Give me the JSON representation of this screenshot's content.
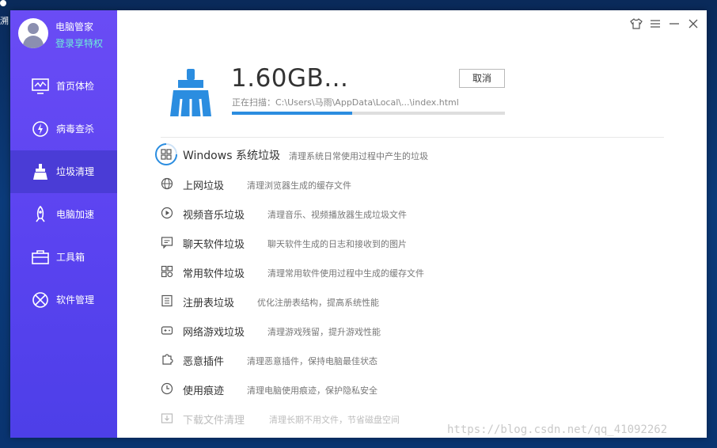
{
  "desktop": {
    "icon_text": "溯"
  },
  "app": {
    "user": {
      "name": "电脑管家",
      "login_link": "登录享特权"
    },
    "nav": [
      {
        "label": "首页体检",
        "icon": "monitor-icon",
        "active": false
      },
      {
        "label": "病毒查杀",
        "icon": "virus-scan-icon",
        "active": false
      },
      {
        "label": "垃圾清理",
        "icon": "broom-icon",
        "active": true
      },
      {
        "label": "电脑加速",
        "icon": "rocket-icon",
        "active": false
      },
      {
        "label": "工具箱",
        "icon": "toolbox-icon",
        "active": false
      },
      {
        "label": "软件管理",
        "icon": "software-icon",
        "active": false
      }
    ],
    "window_controls": [
      "skin-icon",
      "menu-icon",
      "minimize-icon",
      "close-icon"
    ]
  },
  "scan": {
    "size": "1.60GB...",
    "cancel_label": "取消",
    "path_prefix": "正在扫描：",
    "path": "C:\\Users\\马雨\\AppData\\Local\\...\\index.html",
    "progress": 0.44,
    "accent": "#2b8de0"
  },
  "items": [
    {
      "title": "Windows 系统垃圾",
      "desc": "清理系统日常使用过程中产生的垃圾",
      "icon": "windows-scanning-icon"
    },
    {
      "title": "上网垃圾",
      "desc": "清理浏览器生成的缓存文件",
      "icon": "globe-icon"
    },
    {
      "title": "视频音乐垃圾",
      "desc": "清理音乐、视频播放器生成垃圾文件",
      "icon": "play-icon"
    },
    {
      "title": "聊天软件垃圾",
      "desc": "聊天软件生成的日志和接收到的图片",
      "icon": "chat-icon"
    },
    {
      "title": "常用软件垃圾",
      "desc": "清理常用软件使用过程中生成的缓存文件",
      "icon": "apps-icon"
    },
    {
      "title": "注册表垃圾",
      "desc": "优化注册表结构，提高系统性能",
      "icon": "registry-icon"
    },
    {
      "title": "网络游戏垃圾",
      "desc": "清理游戏残留，提升游戏性能",
      "icon": "gamepad-icon"
    },
    {
      "title": "恶意插件",
      "desc": "清理恶意插件，保持电脑最佳状态",
      "icon": "plugin-icon"
    },
    {
      "title": "使用痕迹",
      "desc": "清理电脑使用痕迹，保护隐私安全",
      "icon": "clock-icon"
    },
    {
      "title": "下载文件清理",
      "desc": "清理长期不用文件，节省磁盘空间",
      "icon": "download-icon"
    }
  ],
  "watermark": "https://blog.csdn.net/qq_41092262"
}
